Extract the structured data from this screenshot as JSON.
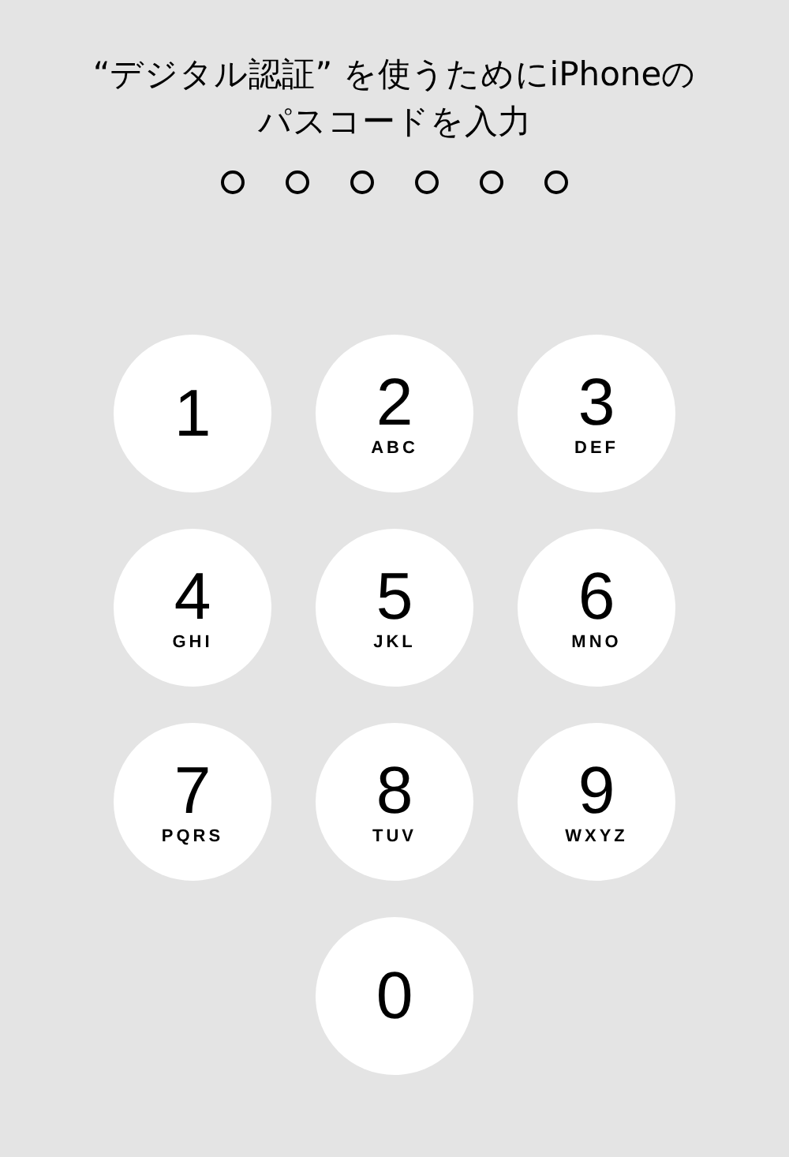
{
  "prompt": {
    "lines": [
      "“デジタル認証” を使うためにiPhoneの",
      "パスコードを入力"
    ]
  },
  "passcode_dots": [
    {
      "filled": false
    },
    {
      "filled": false
    },
    {
      "filled": false
    },
    {
      "filled": false
    },
    {
      "filled": false
    },
    {
      "filled": false
    }
  ],
  "keypad": [
    {
      "digit": "1"
    },
    {
      "digit": "2",
      "letters": "ABC"
    },
    {
      "digit": "3",
      "letters": "DEF"
    },
    {
      "digit": "4",
      "letters": "GHI"
    },
    {
      "digit": "5",
      "letters": "JKL"
    },
    {
      "digit": "6",
      "letters": "MNO"
    },
    {
      "digit": "7",
      "letters": "PQRS"
    },
    {
      "digit": "8",
      "letters": "TUV"
    },
    {
      "digit": "9",
      "letters": "WXYZ"
    },
    {
      "digit": "0"
    }
  ]
}
